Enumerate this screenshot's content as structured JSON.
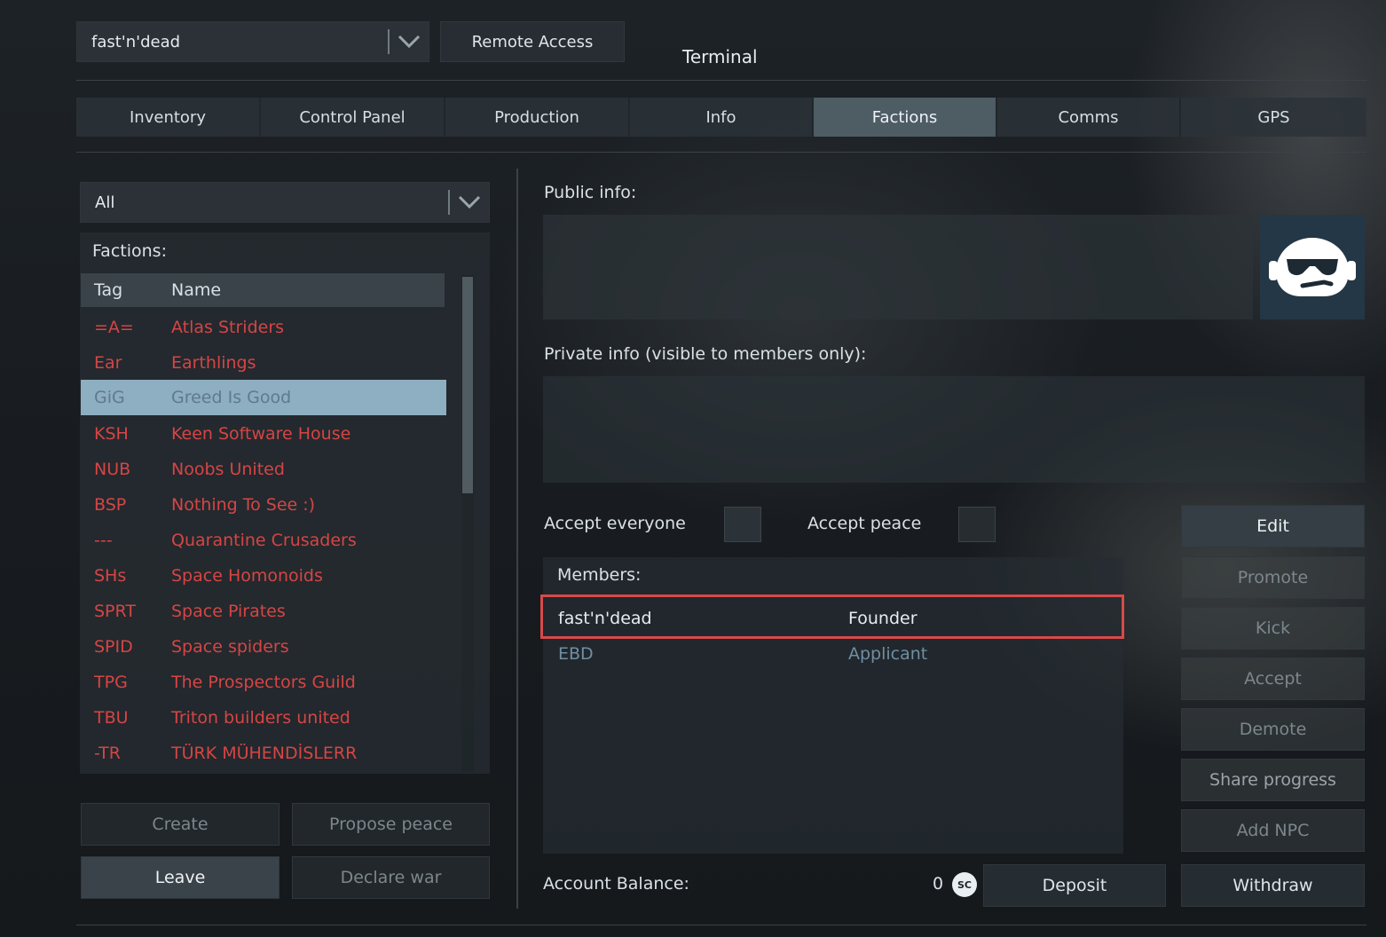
{
  "header": {
    "character_select": "fast'n'dead",
    "remote_access_label": "Remote Access",
    "title": "Terminal"
  },
  "tabs": [
    {
      "label": "Inventory"
    },
    {
      "label": "Control Panel"
    },
    {
      "label": "Production"
    },
    {
      "label": "Info"
    },
    {
      "label": "Factions",
      "active": true
    },
    {
      "label": "Comms"
    },
    {
      "label": "GPS"
    }
  ],
  "factions_panel": {
    "filter_value": "All",
    "list_title": "Factions:",
    "columns": {
      "tag": "Tag",
      "name": "Name"
    },
    "rows": [
      {
        "tag": "=A=",
        "name": "Atlas Striders"
      },
      {
        "tag": "Ear",
        "name": "Earthlings"
      },
      {
        "tag": "GiG",
        "name": "Greed Is Good",
        "selected": true
      },
      {
        "tag": "KSH",
        "name": "Keen Software House"
      },
      {
        "tag": "NUB",
        "name": "Noobs United"
      },
      {
        "tag": "BSP",
        "name": "Nothing To See :)"
      },
      {
        "tag": "---",
        "name": "Quarantine Crusaders"
      },
      {
        "tag": "SHs",
        "name": "Space Homonoids"
      },
      {
        "tag": "SPRT",
        "name": "Space Pirates"
      },
      {
        "tag": "SPID",
        "name": "Space spiders"
      },
      {
        "tag": "TPG",
        "name": "The Prospectors Guild"
      },
      {
        "tag": "TBU",
        "name": "Triton builders united"
      },
      {
        "tag": "-TR",
        "name": "TÜRK MÜHENDİSLERR"
      }
    ],
    "buttons": {
      "create": "Create",
      "propose_peace": "Propose peace",
      "leave": "Leave",
      "declare_war": "Declare war"
    }
  },
  "detail_panel": {
    "public_info_label": "Public info:",
    "private_info_label": "Private info (visible to members only):",
    "accept_everyone_label": "Accept everyone",
    "accept_peace_label": "Accept peace",
    "members_label": "Members:",
    "members": [
      {
        "name": "fast'n'dead",
        "role": "Founder",
        "highlighted": true
      },
      {
        "name": "EBD",
        "role": "Applicant"
      }
    ],
    "account_balance_label": "Account Balance:",
    "account_balance_value": "0",
    "currency_symbol": "SC",
    "deposit_label": "Deposit",
    "withdraw_label": "Withdraw"
  },
  "action_buttons": {
    "edit": "Edit",
    "promote": "Promote",
    "kick": "Kick",
    "accept": "Accept",
    "demote": "Demote",
    "share_progress": "Share progress",
    "add_npc": "Add NPC"
  },
  "colors": {
    "faction_text": "#d64545",
    "selected_row": "#8eaec1",
    "active_tab": "#4e5c64",
    "highlight_box": "#d84a4a",
    "applicant_text": "#6f8fa3"
  },
  "icons": {
    "faction_icon": "sunglasses-face-icon",
    "currency": "space-credit-icon",
    "dropdown": "chevron-down-icon"
  }
}
